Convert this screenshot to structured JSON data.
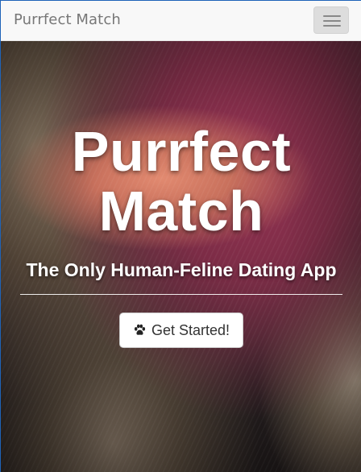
{
  "navbar": {
    "brand": "Purrfect Match",
    "toggle_icon": "hamburger-menu-icon"
  },
  "hero": {
    "title": "Purrfect Match",
    "subtitle": "The Only Human-Feline Dating App",
    "cta_label": "Get Started!",
    "cta_icon": "paw-icon"
  }
}
